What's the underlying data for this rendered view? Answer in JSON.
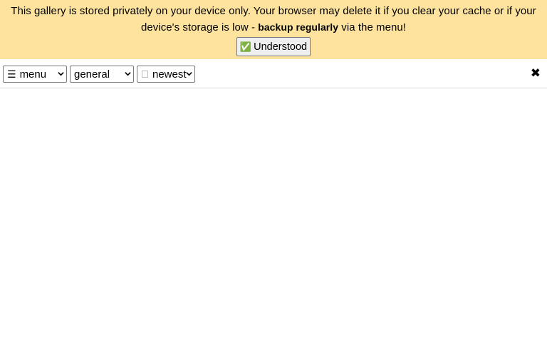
{
  "notice": {
    "text_before": "This gallery is stored privately on your device only. Your browser may delete it if you clear your cache or if your device's storage is low - ",
    "text_bold": "backup regularly",
    "text_after": " via the menu!",
    "button_label": "Understood",
    "button_icon": "check-icon",
    "background_color": "#fee39e"
  },
  "toolbar": {
    "menu_select": {
      "icon": "hamburger-icon",
      "selected": "menu"
    },
    "category_select": {
      "selected": "general"
    },
    "sort_select": {
      "selected": "newest"
    },
    "close_icon": "close-icon"
  },
  "gallery": {
    "items": []
  }
}
